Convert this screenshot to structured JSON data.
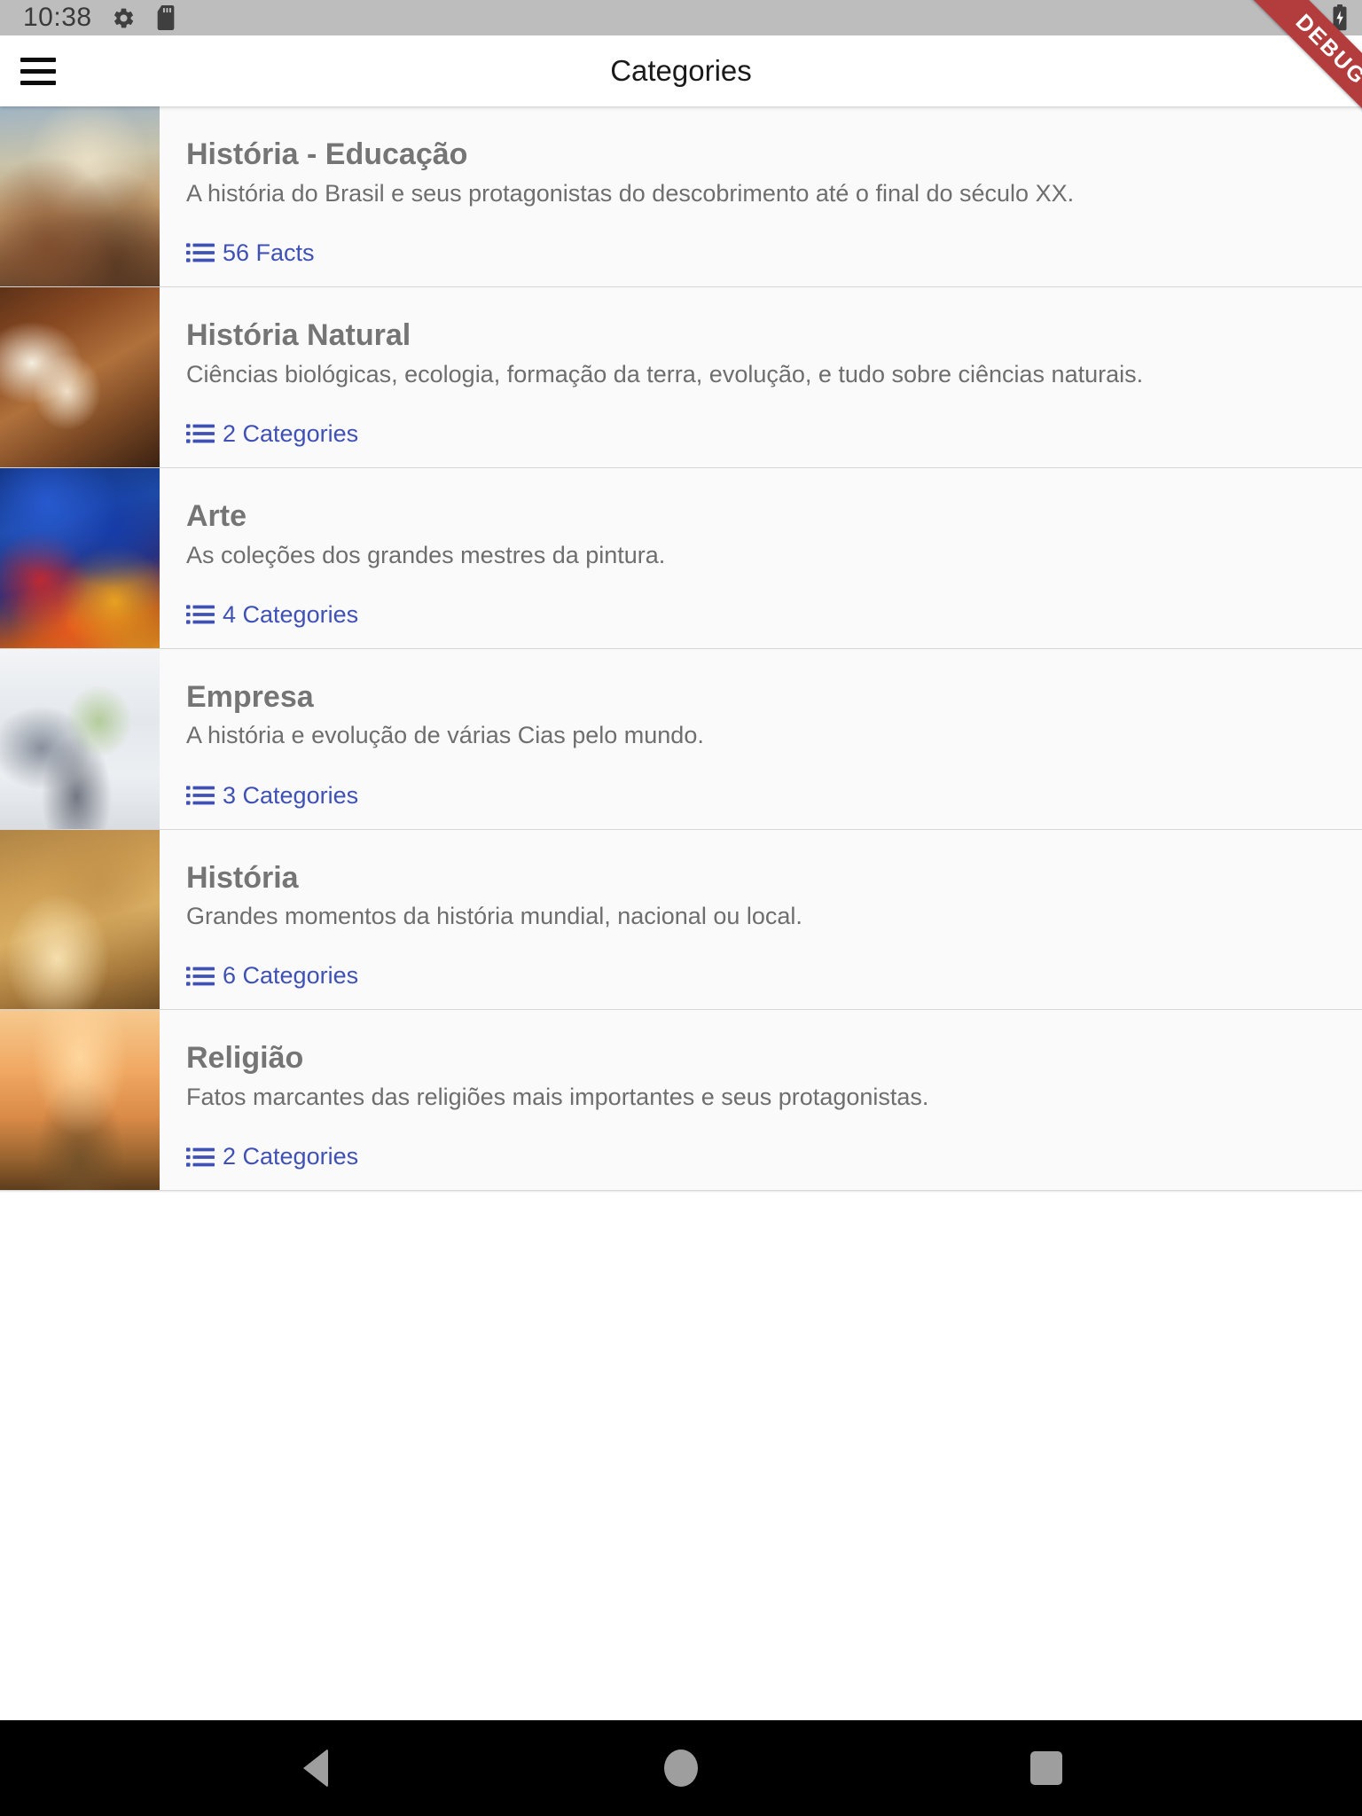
{
  "status_bar": {
    "clock": "10:38",
    "left_icons": [
      "gear-icon",
      "sd-card-icon"
    ],
    "right_icons": [
      "wifi-icon",
      "battery-charging-icon"
    ],
    "background_color": "#bdbdbd"
  },
  "debug_banner": {
    "label": "DEBUG",
    "color": "#b33c3c"
  },
  "app_bar": {
    "title": "Categories",
    "menu_icon": "hamburger-menu-icon"
  },
  "theme": {
    "accent_color": "#3f51b5",
    "title_color": "#757575",
    "description_color": "#6e6e6e",
    "card_background": "#fafafa"
  },
  "categories": [
    {
      "title": "História - Educação",
      "description": "A história do Brasil e seus protagonistas do descobrimento até o final do século XX.",
      "count_label": "56 Facts",
      "thumb_class": "t-historia-edu",
      "thumb_name": "thumbnail-historia-educacao"
    },
    {
      "title": "História Natural",
      "description": "Ciências biológicas, ecologia, formação da terra, evolução, e tudo sobre ciências naturais.",
      "count_label": "2 Categories",
      "thumb_class": "t-historia-nat",
      "thumb_name": "thumbnail-historia-natural"
    },
    {
      "title": "Arte",
      "description": "As coleções dos grandes mestres da pintura.",
      "count_label": "4 Categories",
      "thumb_class": "t-arte",
      "thumb_name": "thumbnail-arte"
    },
    {
      "title": "Empresa",
      "description": "A história e evolução de várias Cias pelo mundo.",
      "count_label": "3 Categories",
      "thumb_class": "t-empresa",
      "thumb_name": "thumbnail-empresa"
    },
    {
      "title": "História",
      "description": "Grandes momentos da história mundial, nacional ou local.",
      "count_label": "6 Categories",
      "thumb_class": "t-historia",
      "thumb_name": "thumbnail-historia"
    },
    {
      "title": "Religião",
      "description": "Fatos marcantes das religiões mais importantes e seus protagonistas.",
      "count_label": "2 Categories",
      "thumb_class": "t-religiao",
      "thumb_name": "thumbnail-religiao"
    }
  ],
  "nav_bar": {
    "back": "back-triangle-icon",
    "home": "home-circle-icon",
    "recents": "recents-square-icon"
  }
}
